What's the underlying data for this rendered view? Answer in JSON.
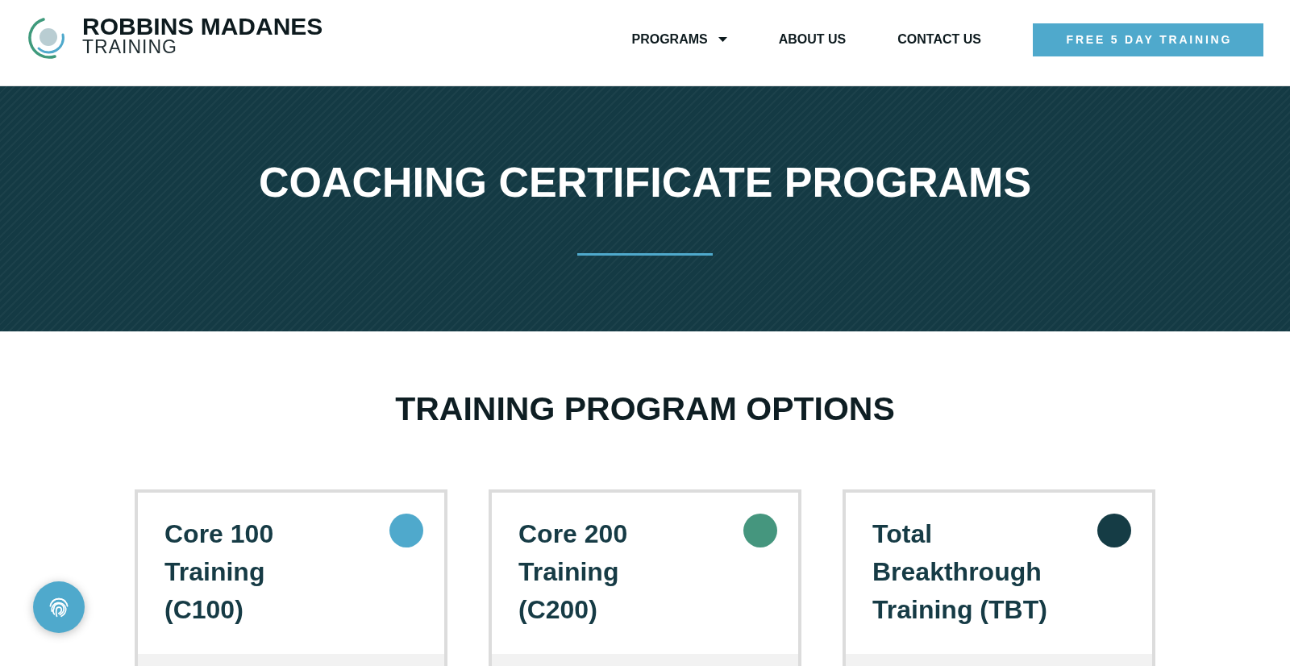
{
  "header": {
    "logo": {
      "name": "ROBBINS MADANES",
      "subtitle": "TRAINING"
    },
    "nav": [
      {
        "label": "PROGRAMS",
        "dropdown": true
      },
      {
        "label": "ABOUT US",
        "dropdown": false
      },
      {
        "label": "CONTACT US",
        "dropdown": false
      }
    ],
    "cta_button": "FREE 5 DAY TRAINING"
  },
  "hero": {
    "title": "COACHING CERTIFICATE PROGRAMS"
  },
  "options": {
    "heading": "TRAINING PROGRAM OPTIONS",
    "cards": [
      {
        "title": "Core 100 Training (C100)",
        "color": "#4fa9cc"
      },
      {
        "title": "Core 200 Training (C200)",
        "color": "#45967e"
      },
      {
        "title": "Total Breakthrough Training (TBT)",
        "color": "#153c45"
      }
    ]
  }
}
